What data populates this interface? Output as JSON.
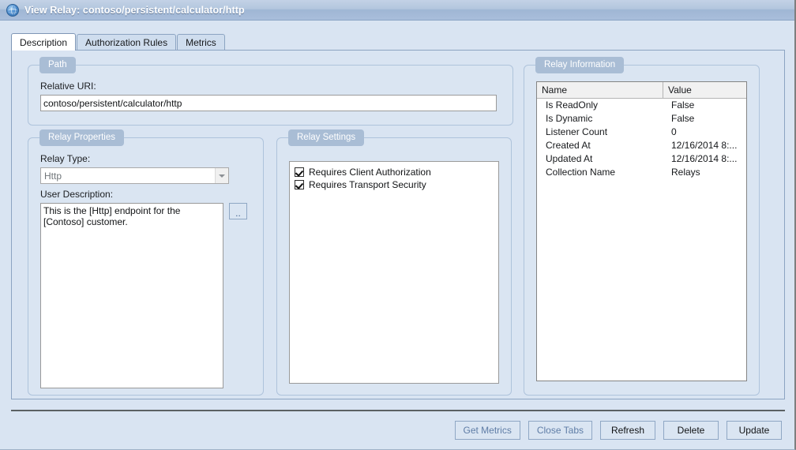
{
  "window": {
    "title": "View Relay: contoso/persistent/calculator/http",
    "icon": "globe-icon"
  },
  "tabs": [
    {
      "label": "Description",
      "selected": true
    },
    {
      "label": "Authorization Rules",
      "selected": false
    },
    {
      "label": "Metrics",
      "selected": false
    }
  ],
  "path_group": {
    "legend": "Path",
    "relative_uri_label": "Relative URI:",
    "relative_uri_value": "contoso/persistent/calculator/http",
    "relative_uri_placeholder": ""
  },
  "relay_properties": {
    "legend": "Relay Properties",
    "relay_type_label": "Relay Type:",
    "relay_type_value": "Http",
    "relay_type_options": [
      "Http"
    ],
    "user_description_label": "User Description:",
    "user_description_value": "This is the [Http] endpoint for the [Contoso] customer.",
    "browse_button_label": ".."
  },
  "relay_settings": {
    "legend": "Relay Settings",
    "items": [
      {
        "label": "Requires Client Authorization",
        "checked": true
      },
      {
        "label": "Requires Transport Security",
        "checked": true
      }
    ]
  },
  "relay_information": {
    "legend": "Relay Information",
    "columns": [
      "Name",
      "Value"
    ],
    "rows": [
      {
        "name": "Is ReadOnly",
        "value": "False"
      },
      {
        "name": "Is Dynamic",
        "value": "False"
      },
      {
        "name": "Listener Count",
        "value": "0"
      },
      {
        "name": "Created At",
        "value": "12/16/2014 8:..."
      },
      {
        "name": "Updated At",
        "value": "12/16/2014 8:..."
      },
      {
        "name": "Collection Name",
        "value": "Relays"
      }
    ]
  },
  "footer": {
    "buttons": [
      {
        "label": "Get Metrics",
        "disabled": true
      },
      {
        "label": "Close Tabs",
        "disabled": true
      },
      {
        "label": "Refresh",
        "disabled": false
      },
      {
        "label": "Delete",
        "disabled": false
      },
      {
        "label": "Update",
        "disabled": false
      }
    ]
  },
  "colors": {
    "window_background": "#d9e4f2",
    "titlebar_gradient_top": "#c3d2e6",
    "titlebar_gradient_bottom": "#a9bedb",
    "group_badge": "#a9bdd5",
    "group_border": "#aec3db",
    "button_face": "#dae5f2",
    "button_border": "#8fa7c4",
    "disabled_text": "#5f7da6"
  }
}
